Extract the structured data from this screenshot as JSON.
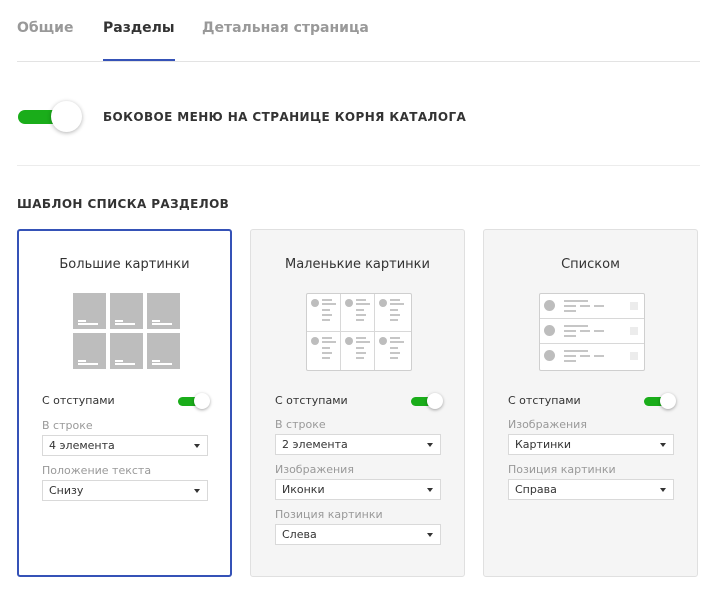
{
  "tabs": [
    {
      "label": "Общие",
      "active": false
    },
    {
      "label": "Разделы",
      "active": true
    },
    {
      "label": "Детальная страница",
      "active": false
    }
  ],
  "side_menu": {
    "label": "БОКОВОЕ МЕНЮ НА СТРАНИЦЕ КОРНЯ КАТАЛОГА",
    "enabled": true
  },
  "section_template": {
    "title": "ШАБЛОН СПИСКА РАЗДЕЛОВ",
    "cards": [
      {
        "title": "Большие картинки",
        "selected": true,
        "preview": "big-tiles",
        "toggle_label": "С отступами",
        "toggle_on": true,
        "fields": [
          {
            "label": "В строке",
            "value": "4 элемента"
          },
          {
            "label": "Положение текста",
            "value": "Снизу"
          }
        ]
      },
      {
        "title": "Маленькие картинки",
        "selected": false,
        "preview": "small-tiles",
        "toggle_label": "С отступами",
        "toggle_on": true,
        "fields": [
          {
            "label": "В строке",
            "value": "2 элемента"
          },
          {
            "label": "Изображения",
            "value": "Иконки"
          },
          {
            "label": "Позиция картинки",
            "value": "Слева"
          }
        ]
      },
      {
        "title": "Списком",
        "selected": false,
        "preview": "list",
        "toggle_label": "С отступами",
        "toggle_on": true,
        "fields": [
          {
            "label": "Изображения",
            "value": "Картинки"
          },
          {
            "label": "Позиция картинки",
            "value": "Справа"
          }
        ]
      }
    ]
  },
  "colors": {
    "accent": "#3552b7",
    "toggle_on": "#1aad1a",
    "card_bg": "#f5f5f5"
  }
}
